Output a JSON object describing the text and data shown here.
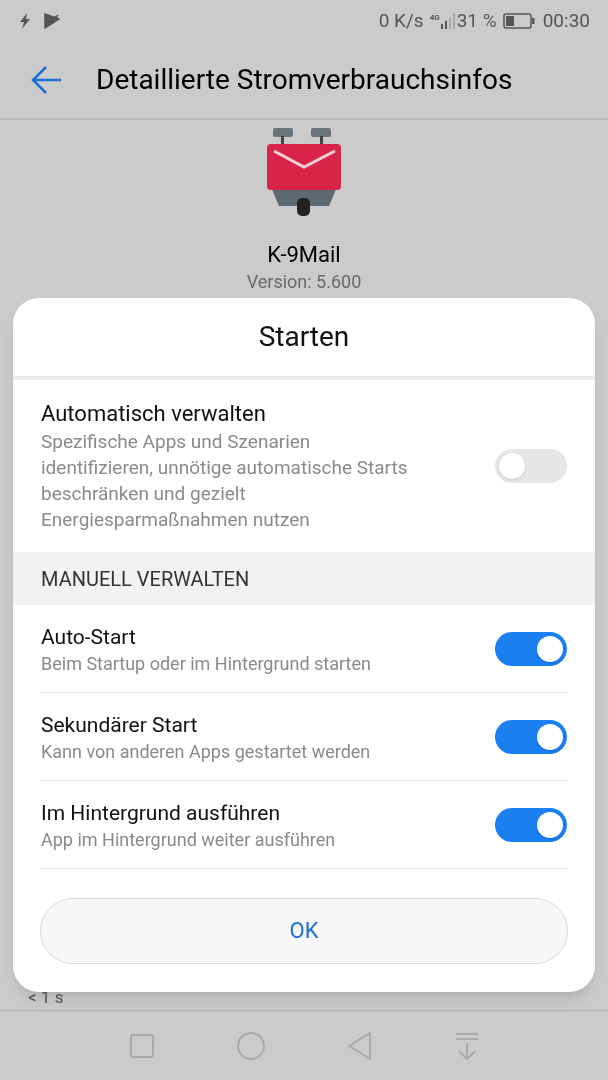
{
  "status_bar": {
    "speed": "0 K/s",
    "network": "4G",
    "battery": "31 %",
    "time": "00:30"
  },
  "app_bar": {
    "title": "Detaillierte Stromverbrauchsinfos"
  },
  "app": {
    "name": "K-9Mail",
    "version": "Version: 5.600"
  },
  "background_texts": {
    "duration": "< 1 s"
  },
  "dialog": {
    "title": "Starten",
    "auto": {
      "title": "Automatisch verwalten",
      "description": "Spezifische Apps und Szenarien identifizieren, unnötige automatische Starts beschränken und gezielt Energiesparmaßnahmen nutzen",
      "on": false
    },
    "section_header": "MANUELL VERWALTEN",
    "options": [
      {
        "title": "Auto-Start",
        "description": "Beim Startup oder im Hintergrund starten",
        "on": true
      },
      {
        "title": "Sekundärer Start",
        "description": "Kann von anderen Apps gestartet werden",
        "on": true
      },
      {
        "title": "Im Hintergrund ausführen",
        "description": "App im Hintergrund weiter ausführen",
        "on": true
      }
    ],
    "button": "OK"
  }
}
